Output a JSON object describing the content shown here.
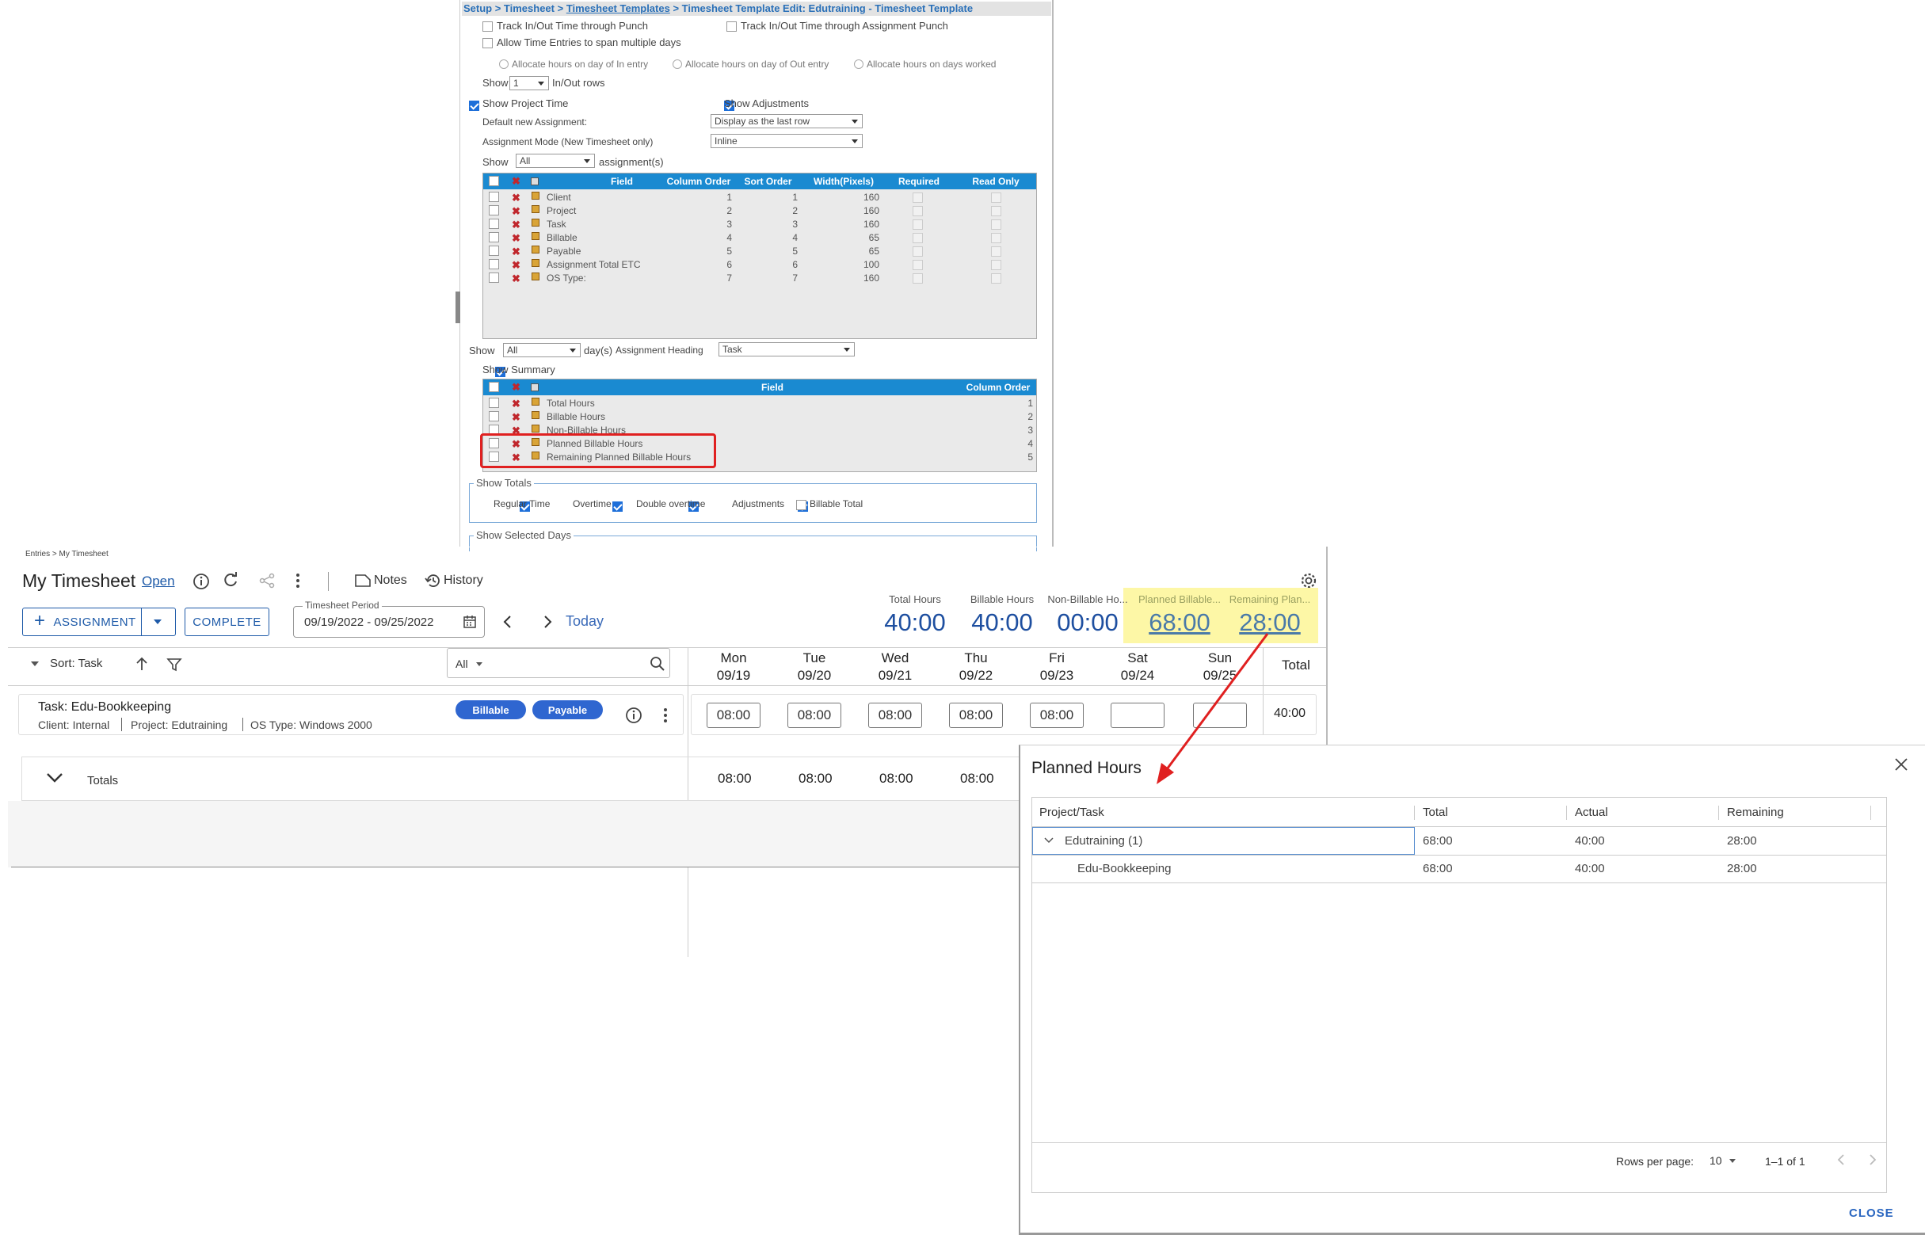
{
  "setup": {
    "breadcrumb": {
      "part1": "Setup > Timesheet > ",
      "link": "Timesheet Templates",
      "part2": " > Timesheet Template Edit: Edutraining - Timesheet Template"
    },
    "track_punch": "Track In/Out Time through Punch",
    "track_assignment_punch": "Track In/Out Time through Assignment Punch",
    "allow_span": "Allow Time Entries to span multiple days",
    "alloc_in": "Allocate hours on day of In entry",
    "alloc_out": "Allocate hours on day of Out entry",
    "alloc_worked": "Allocate hours on days worked",
    "show_label": "Show",
    "inout_value": "1",
    "inout_rows": "In/Out rows",
    "show_project_time": "Show Project Time",
    "show_adjustments": "Show Adjustments",
    "default_assignment_label": "Default new Assignment:",
    "default_assignment_value": "Display as the last row",
    "assignment_mode_label": "Assignment Mode (New Timesheet only)",
    "assignment_mode_value": "Inline",
    "show_assign_value": "All",
    "assignments_suffix": "assignment(s)",
    "assign_grid": {
      "headers": [
        "Field",
        "Column Order",
        "Sort Order",
        "Width(Pixels)",
        "Required",
        "Read Only"
      ],
      "rows": [
        {
          "field": "Client",
          "col": "1",
          "sort": "1",
          "width": "160"
        },
        {
          "field": "Project",
          "col": "2",
          "sort": "2",
          "width": "160"
        },
        {
          "field": "Task",
          "col": "3",
          "sort": "3",
          "width": "160"
        },
        {
          "field": "Billable",
          "col": "4",
          "sort": "4",
          "width": "65"
        },
        {
          "field": "Payable",
          "col": "5",
          "sort": "5",
          "width": "65"
        },
        {
          "field": "Assignment Total ETC",
          "col": "6",
          "sort": "6",
          "width": "100"
        },
        {
          "field": "OS Type:",
          "col": "7",
          "sort": "7",
          "width": "160"
        }
      ]
    },
    "show_days_value": "All",
    "days_suffix": "day(s)",
    "assignment_heading_label": "Assignment Heading",
    "assignment_heading_value": "Task",
    "show_summary": "Show Summary",
    "summary_grid": {
      "headers": [
        "Field",
        "Column Order"
      ],
      "rows": [
        {
          "field": "Total Hours",
          "col": "1"
        },
        {
          "field": "Billable Hours",
          "col": "2"
        },
        {
          "field": "Non-Billable Hours",
          "col": "3"
        },
        {
          "field": "Planned Billable Hours",
          "col": "4"
        },
        {
          "field": "Remaining Planned Billable Hours",
          "col": "5"
        }
      ]
    },
    "show_totals": "Show Totals",
    "totals": [
      "Regular Time",
      "Overtime",
      "Double overtime",
      "Adjustments",
      "Billable Total"
    ],
    "show_selected_days": "Show Selected Days"
  },
  "timesheet": {
    "breadcrumb": "Entries > My Timesheet",
    "title": "My Timesheet",
    "status": "Open",
    "notes": "Notes",
    "history": "History",
    "assignment_btn": "ASSIGNMENT",
    "complete_btn": "COMPLETE",
    "period_label": "Timesheet Period",
    "period_value": "09/19/2022 - 09/25/2022",
    "today": "Today",
    "summary": [
      {
        "label": "Total Hours",
        "value": "40:00"
      },
      {
        "label": "Billable Hours",
        "value": "40:00"
      },
      {
        "label": "Non-Billable Ho...",
        "value": "00:00"
      },
      {
        "label": "Planned Billable...",
        "value": "68:00"
      },
      {
        "label": "Remaining Plan...",
        "value": "28:00"
      }
    ],
    "sort_label": "Sort: Task",
    "filter_value": "All",
    "days": [
      {
        "d": "Mon",
        "date": "09/19"
      },
      {
        "d": "Tue",
        "date": "09/20"
      },
      {
        "d": "Wed",
        "date": "09/21"
      },
      {
        "d": "Thu",
        "date": "09/22"
      },
      {
        "d": "Fri",
        "date": "09/23"
      },
      {
        "d": "Sat",
        "date": "09/24"
      },
      {
        "d": "Sun",
        "date": "09/25"
      }
    ],
    "total_header": "Total",
    "task_title": "Task: Edu-Bookkeeping",
    "client": "Client: Internal",
    "project": "Project: Edutraining",
    "os_type": "OS Type: Windows 2000",
    "badges": [
      "Billable",
      "Payable"
    ],
    "entries": [
      "08:00",
      "08:00",
      "08:00",
      "08:00",
      "08:00",
      "",
      ""
    ],
    "row_total": "40:00",
    "totals_label": "Totals",
    "totals_values": [
      "08:00",
      "08:00",
      "08:00",
      "08:00"
    ]
  },
  "dialog": {
    "title": "Planned Hours",
    "headers": [
      "Project/Task",
      "Total",
      "Actual",
      "Remaining"
    ],
    "group": {
      "name": "Edutraining (1)",
      "total": "68:00",
      "actual": "40:00",
      "remaining": "28:00"
    },
    "child": {
      "name": "Edu-Bookkeeping",
      "total": "68:00",
      "actual": "40:00",
      "remaining": "28:00"
    },
    "rows_per_page_label": "Rows per page:",
    "rows_per_page": "10",
    "range": "1–1 of 1",
    "close": "CLOSE"
  },
  "colors": {
    "accent": "#1e5aa8",
    "grid_header": "#1a8ad1",
    "highlight": "#fdf7a6",
    "callout": "#e02020"
  }
}
